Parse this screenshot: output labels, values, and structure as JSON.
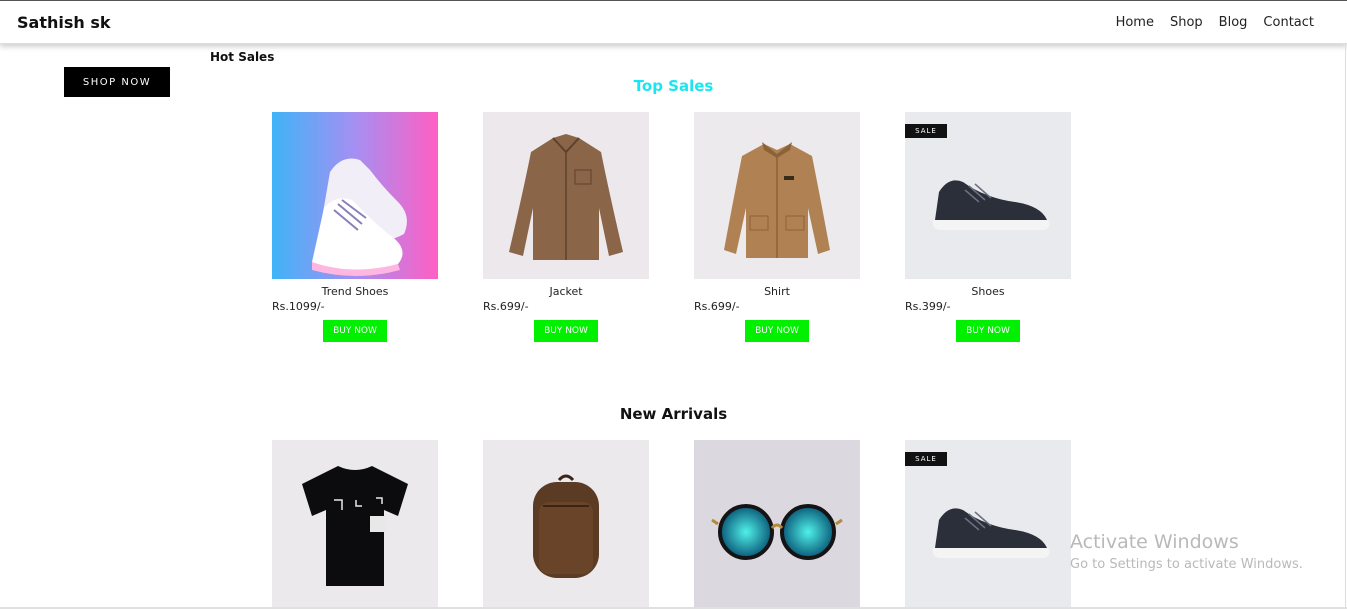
{
  "nav": {
    "brand": "Sathish sk",
    "links": [
      "Home",
      "Shop",
      "Blog",
      "Contact"
    ]
  },
  "hero": {
    "shop_now": "SHOP NOW",
    "hot_sales": "Hot Sales"
  },
  "top_sales": {
    "title": "Top Sales",
    "title_color": "#19e6f0",
    "products": [
      {
        "name": "Trend Shoes",
        "price": "Rs.1099/-",
        "button": "BUY NOW",
        "image": "sneaker-photo"
      },
      {
        "name": "Jacket",
        "price": "Rs.699/-",
        "button": "BUY NOW",
        "image": "jacket-photo"
      },
      {
        "name": "Shirt",
        "price": "Rs.699/-",
        "button": "BUY NOW",
        "image": "shirt-photo"
      },
      {
        "name": "Shoes",
        "price": "Rs.399/-",
        "button": "BUY NOW",
        "image": "shoe-photo",
        "badge": "SALE"
      }
    ]
  },
  "new_arrivals": {
    "title": "New Arrivals",
    "products": [
      {
        "image": "tshirt-photo"
      },
      {
        "image": "backpack-photo"
      },
      {
        "image": "sunglasses-photo"
      },
      {
        "image": "shoe-photo",
        "badge": "SALE"
      }
    ]
  },
  "button_color": "#00f000",
  "watermark": {
    "line1": "Activate Windows",
    "line2": "Go to Settings to activate Windows."
  }
}
